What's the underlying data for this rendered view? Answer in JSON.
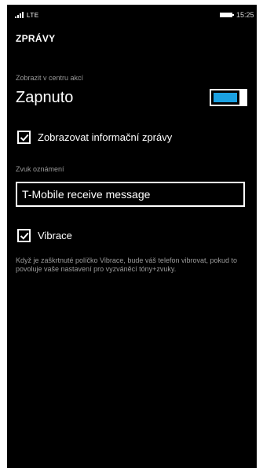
{
  "status_bar": {
    "network": "LTE",
    "time": "15:25"
  },
  "page": {
    "title": "ZPRÁVY"
  },
  "action_center": {
    "label": "Zobrazit v centru akcí",
    "state": "Zapnuto",
    "enabled": true
  },
  "info_messages": {
    "label": "Zobrazovat informační zprávy",
    "checked": true
  },
  "notification_sound": {
    "label": "Zvuk oznámení",
    "value": "T-Mobile receive message"
  },
  "vibration": {
    "label": "Vibrace",
    "checked": true,
    "help": "Když je zaškrtnuté políčko Vibrace, bude váš telefon vibrovat, pokud to povoluje vaše nastavení pro vyzváněcí tóny+zvuky."
  },
  "colors": {
    "background": "#000000",
    "accent": "#1ba1e2",
    "secondary_text": "#9a9a9a"
  }
}
